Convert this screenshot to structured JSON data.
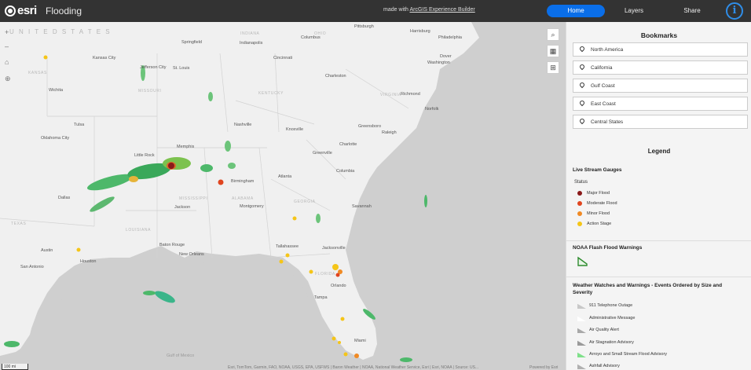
{
  "header": {
    "logo_text": "esri",
    "app_title": "Flooding",
    "made_with_prefix": "made with",
    "made_with_link": "ArcGIS Experience Builder",
    "nav": {
      "home": "Home",
      "layers": "Layers",
      "share": "Share"
    },
    "info_label": "i",
    "colors": {
      "bar": "#333333",
      "active_tab": "#0a6ee8",
      "info": "#2f8de8"
    }
  },
  "map": {
    "labels": {
      "united_states": "U N I T E D   S T A T E S",
      "kansas": "KANSAS",
      "missouri": "MISSOURI",
      "kentucky": "KENTUCKY",
      "virginia": "VIRGINIA",
      "mississippi": "MISSISSIPPI",
      "alabama": "ALABAMA",
      "georgia": "GEORGIA",
      "louisiana": "LOUISIANA",
      "texas": "TEXAS",
      "ohio": "OHIO",
      "indiana": "INDIANA",
      "florida": "FLORIDA",
      "cities": [
        "Kansas City",
        "Jefferson City",
        "St. Louis",
        "Springfield",
        "Indianapolis",
        "Cincinnati",
        "Columbus",
        "Pittsburgh",
        "Harrisburg",
        "Philadelphia",
        "Dover",
        "Washington",
        "Charleston",
        "Richmond",
        "Norfolk",
        "Wichita",
        "Tulsa",
        "Oklahoma City",
        "Nashville",
        "Knoxville",
        "Greensboro",
        "Raleigh",
        "Memphis",
        "Little Rock",
        "Charlotte",
        "Greenville",
        "Columbia",
        "Atlanta",
        "Birmingham",
        "Dallas",
        "Jackson",
        "Montgomery",
        "Savannah",
        "Austin",
        "Houston",
        "San Antonio",
        "Baton Rouge",
        "New Orleans",
        "Tallahassee",
        "Jacksonville",
        "Orlando",
        "Tampa",
        "Miami",
        "Gulf of Mexico"
      ]
    },
    "attribution": "Esri, TomTom, Garmin, FAO, NOAA, USGS, EPA, USFWS | Baron Weather | NOAA, National Weather Service, Esri | Esri, NOAA | Source: US...",
    "powered_by": "Powered by Esri",
    "scale": "100 mi",
    "zoom_in": "+",
    "zoom_out": "–"
  },
  "sidebar": {
    "bookmarks_title": "Bookmarks",
    "bookmarks": [
      "North America",
      "California",
      "Gulf Coast",
      "East Coast",
      "Central States"
    ],
    "legend_title": "Legend",
    "gauges": {
      "title": "Live Stream Gauges",
      "status_label": "Status",
      "items": [
        {
          "label": "Major Flood",
          "color": "#8b1a1a"
        },
        {
          "label": "Moderate Flood",
          "color": "#e0451f"
        },
        {
          "label": "Minor Flood",
          "color": "#f08a24"
        },
        {
          "label": "Action Stage",
          "color": "#f5c518"
        }
      ]
    },
    "noaa": {
      "title": "NOAA Flash Flood Warnings",
      "color": "#2e8b2e"
    },
    "watches": {
      "title": "Weather Watches and Warnings - Events Ordered by Size and Severity",
      "items": [
        {
          "label": "911 Telephone Outage",
          "color": "#c8c8c8"
        },
        {
          "label": "Administrative Message",
          "color": "#ffffff"
        },
        {
          "label": "Air Quality Alert",
          "color": "#a8a8a8"
        },
        {
          "label": "Air Stagnation Advisory",
          "color": "#9a9a9a"
        },
        {
          "label": "Arroyo and Small Stream Flood Advisory",
          "color": "#7fe08a"
        },
        {
          "label": "Ashfall Advisory",
          "color": "#b0b0b0"
        }
      ]
    }
  }
}
